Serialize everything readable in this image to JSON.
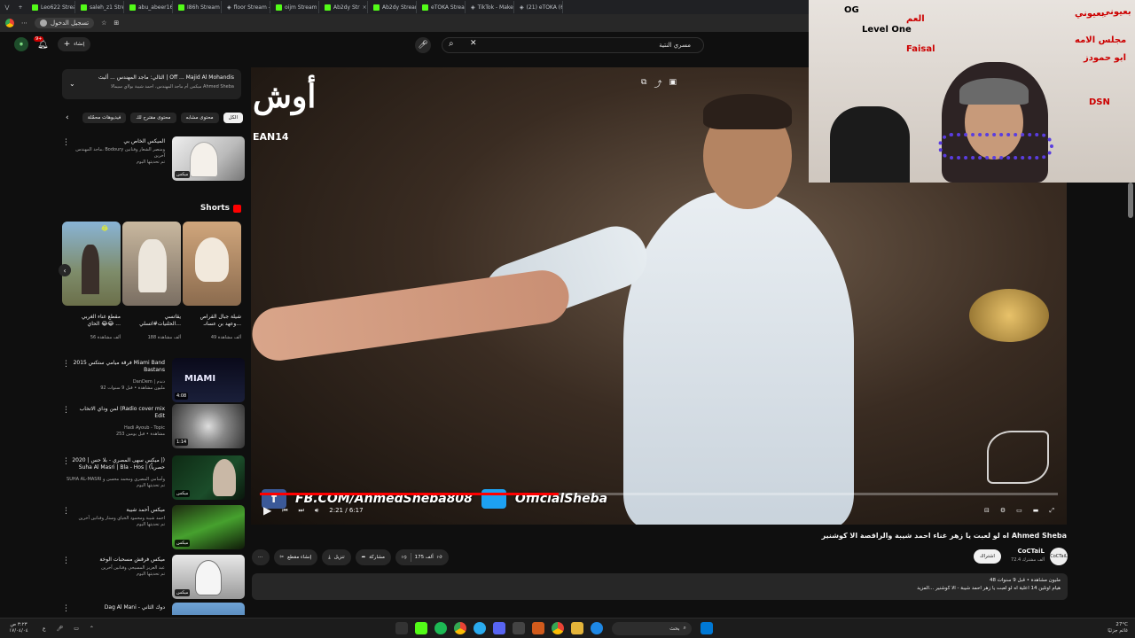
{
  "browser": {
    "tabs": [
      {
        "label": "Leo622 Stream",
        "kick": true
      },
      {
        "label": "saleh_z1 Stream",
        "kick": true
      },
      {
        "label": "abu_abeer16 Str",
        "kick": true
      },
      {
        "label": "I86h Stream",
        "kick": true
      },
      {
        "label": "floor Stream -",
        "kick": false
      },
      {
        "label": "oijm Stream",
        "kick": true
      },
      {
        "label": "Ab2dy Str",
        "kick": true
      },
      {
        "label": "Ab2dy Stream",
        "kick": true
      },
      {
        "label": "eTOKA Stream",
        "kick": true
      },
      {
        "label": "TikTok - Make",
        "kick": false
      },
      {
        "label": "(21) eTOKA (6",
        "kick": false
      }
    ],
    "signin_label": "تسجيل الدخول"
  },
  "header": {
    "create_label": "إنشاء",
    "search_value": "مسري النتية",
    "notif_count": "9+"
  },
  "sidebar": {
    "playlist": {
      "title": "التالي: ماجد المهندس ... ألبث | Off ... Majid Al Mohandis",
      "subtitle": "ميكس أم ماجد المهندس، احمد شيبة بولاي سيمالا Ahmed Sheba"
    },
    "chips": [
      "الكل",
      "محتوى مشابه",
      "محتوى مقترح لك",
      "فيديوهات محمّلة"
    ],
    "first_rec": {
      "title": "الميكس الخاص بي",
      "meta1": "ماجد المهندس، Bodoury ومنصر الشعار وفنانين آخرين",
      "meta2": "تم تحديثها اليوم",
      "badge": "ميكس"
    },
    "shorts_title": "Shorts",
    "shorts": [
      {
        "title": "شيلة جبال القراص",
        "title2": "وعهد بن عسانـ...",
        "views": "49 ألف مشاهدة"
      },
      {
        "title": "يقاتسي",
        "title2": "الحلنيات#اتسلي...",
        "views": "188 ألف مشاهدة"
      },
      {
        "title": "مقطع غناء الغربي",
        "title2": "الحاي 😂😂 ...",
        "views": "56 ألف مشاهدة"
      }
    ],
    "recs": [
      {
        "title": "فرقة ميامي ستكس 2015 Miami Band",
        "title2": "Bastans",
        "meta1": "DanDem | دندم",
        "meta2": "92 مليون مشاهدة • قبل 9 سنوات",
        "dur": "4:08"
      },
      {
        "title": "لمن وداي الاتخاب (Radio cover mix",
        "title2": "Edit",
        "meta1": "Hadi Ayoub - Topic",
        "meta2": "253 مشاهدة • قبل يومين",
        "dur": "1:14"
      },
      {
        "title": "ميكس سهى المصري - بلا حس | 2020 |)",
        "title2": "Suha Al Masri | Bla - Hos | (حصرياً",
        "meta1": "SUHA AL-MASRI وأسامي المصري ومحمد محسن و",
        "meta2": "تم تحديثها اليوم",
        "badge": "ميكس"
      },
      {
        "title": "ميكس أحمد شيبة",
        "title2": "",
        "meta1": "احمد شيبة ومحمود الخياي وستار وفنانين آخرين",
        "meta2": "تم تحديثها اليوم",
        "badge": "ميكس"
      },
      {
        "title": "ميكس فرقش مسحبات الوخة",
        "title2": "",
        "meta1": "عبد العزيز المسيحي وفنانين آخرين",
        "meta2": "تم تحديثها اليوم",
        "badge": "ميكس"
      },
      {
        "title": "Dag Al Mani - دوك الثاني",
        "title2": "",
        "meta1": "",
        "meta2": ""
      }
    ]
  },
  "video": {
    "current_time": "2:21",
    "duration": "6:17",
    "progress": 0.374,
    "watermark_top": "أوش",
    "watermark_sub": "EAN14",
    "overlay_fb": "FB.COM/AhmedSheba808",
    "overlay_tw": "OfficialSheba",
    "title": "اه لو لعبت يا زهر غناء احمد شيبة والراقصة الا كوشنير Ahmed Sheba",
    "channel": "CoCTaiL",
    "subscribers": "72.4 ألف مشترك",
    "subscribe_label": "اشتراك",
    "likes": "175 ألف",
    "share_label": "مشاركة",
    "download_label": "تنزيل",
    "clip_label": "إنشاء مقطع",
    "desc_line1": "48 مليون مشاهدة • قبل 9 سنوات",
    "desc_line2": "هيام اونلين 14 اعلية اه لو لعبت يا زهر احمد شيبة - الا كوشنير ...المزيد"
  },
  "webcam": {
    "wall_words": [
      "بعيوني",
      "OG",
      "العم",
      "Level One",
      "Faisal",
      "مجلس الامه",
      "ابو حمودز",
      "DSN",
      "بعيوني"
    ]
  },
  "taskbar": {
    "time": "٣:٢٣ ص",
    "date": "١٧/٠٤/٠٤",
    "search_placeholder": "بحث",
    "weather": "27°C",
    "weather_sub": "غائم جزئيًا"
  }
}
